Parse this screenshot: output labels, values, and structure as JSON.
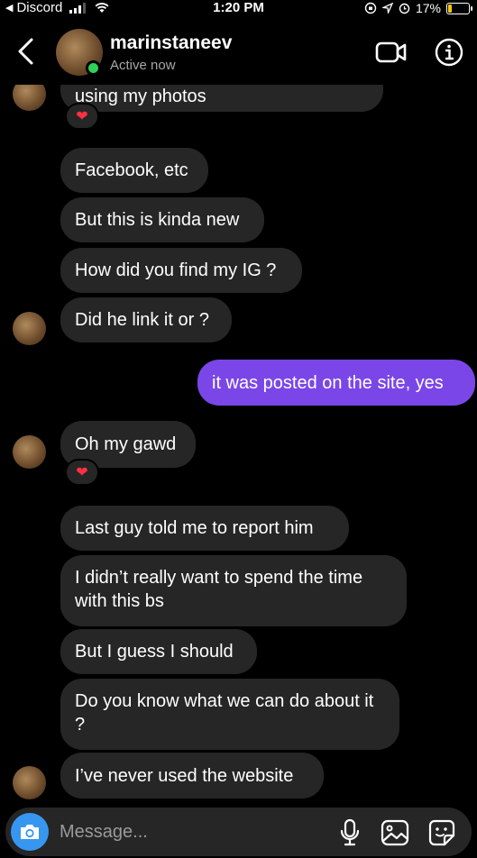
{
  "status_bar": {
    "back_app": "Discord",
    "time": "1:20 PM",
    "battery_percent": "17%",
    "battery_level": 0.17,
    "battery_color": "#f5c518"
  },
  "header": {
    "contact_name": "marinstaneev",
    "status": "Active now",
    "online_color": "#2fd158",
    "icons": [
      "back-chevron-icon",
      "video-call-icon",
      "info-icon"
    ]
  },
  "messages": [
    {
      "from": "them",
      "text": "using my photos",
      "reaction": "❤"
    },
    {
      "from": "them",
      "text": "Facebook, etc"
    },
    {
      "from": "them",
      "text": "But this is kinda new"
    },
    {
      "from": "them",
      "text": "How did you find my IG ?"
    },
    {
      "from": "them",
      "text": "Did he link it or ?"
    },
    {
      "from": "me",
      "text": "it was posted on the site, yes"
    },
    {
      "from": "them",
      "text": "Oh my gawd",
      "reaction": "❤"
    },
    {
      "from": "them",
      "text": "Last guy told me to report him"
    },
    {
      "from": "them",
      "text": "I didn’t really want to spend the time with this bs"
    },
    {
      "from": "them",
      "text": "But I guess I should"
    },
    {
      "from": "them",
      "text": "Do you know what we can do about it ?"
    },
    {
      "from": "them",
      "text": "I’ve never used the website"
    }
  ],
  "composer": {
    "placeholder": "Message...",
    "camera_color": "#3797f0",
    "icons": [
      "camera-icon",
      "microphone-icon",
      "gallery-icon",
      "sticker-icon"
    ]
  },
  "colors": {
    "incoming_bubble": "#262626",
    "outgoing_bubble": "#7a46e8",
    "background": "#000000"
  }
}
